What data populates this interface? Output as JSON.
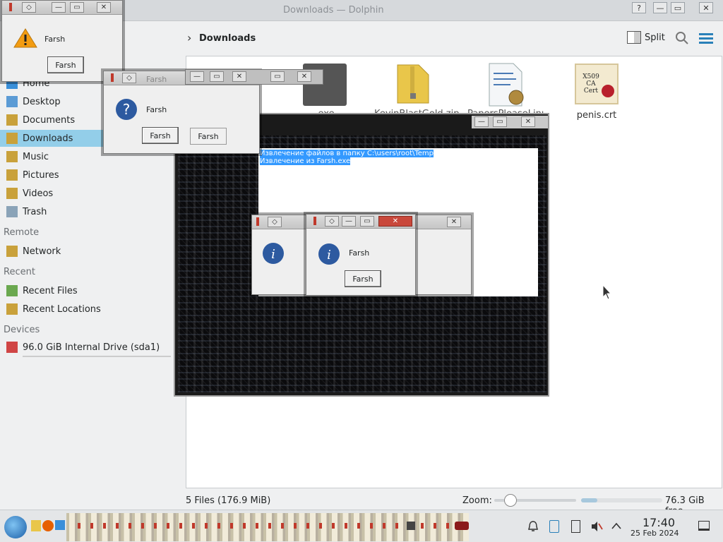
{
  "window": {
    "title": "Downloads — Dolphin"
  },
  "toolbar": {
    "breadcrumb_arrow": "›",
    "location": "Downloads",
    "split_label": "Split"
  },
  "sidebar": {
    "items": [
      {
        "label": "Home",
        "icon": "home-icon"
      },
      {
        "label": "Desktop",
        "icon": "desktop-icon"
      },
      {
        "label": "Documents",
        "icon": "documents-icon"
      },
      {
        "label": "Downloads",
        "icon": "downloads-icon",
        "selected": true
      },
      {
        "label": "Music",
        "icon": "music-icon"
      },
      {
        "label": "Pictures",
        "icon": "pictures-icon"
      },
      {
        "label": "Videos",
        "icon": "videos-icon"
      },
      {
        "label": "Trash",
        "icon": "trash-icon"
      }
    ],
    "remote_header": "Remote",
    "remote_items": [
      {
        "label": "Network"
      }
    ],
    "recent_header": "Recent",
    "recent_items": [
      {
        "label": "Recent Files"
      },
      {
        "label": "Recent Locations"
      }
    ],
    "devices_header": "Devices",
    "device_items": [
      {
        "label": "96.0 GiB Internal Drive (sda1)"
      }
    ]
  },
  "files": [
    {
      "name": ".exe"
    },
    {
      "name": "KevinBlastGold.zip"
    },
    {
      "name": "PapersPleaseLinux.sh"
    },
    {
      "name": "penis.crt"
    }
  ],
  "certificate_icon_text": "X509 CA Cert",
  "statusbar": {
    "summary": "5 Files (176.9 MiB)",
    "zoom_label": "Zoom:",
    "zoom_level": 0.2,
    "free_space": "76.3 GiB free",
    "free_fraction": 0.2
  },
  "dialogs": {
    "warning": {
      "message": "Farsh",
      "button": "Farsh"
    },
    "question": {
      "title": "Farsh",
      "message": "Farsh",
      "button1": "Farsh",
      "button2": "Farsh"
    },
    "info": {
      "message": "Farsh",
      "button": "Farsh"
    }
  },
  "extract_window": {
    "line1": "Извлечение файлов в папку C:\\users\\root\\Temp",
    "line2": "Извлечение из Farsh.exe"
  },
  "taskbar": {
    "clock_time": "17:40",
    "clock_date": "25 Feb 2024"
  },
  "colors": {
    "accent": "#3daee9",
    "selection": "#93cee9",
    "titlebar_red": "#c9483b"
  }
}
